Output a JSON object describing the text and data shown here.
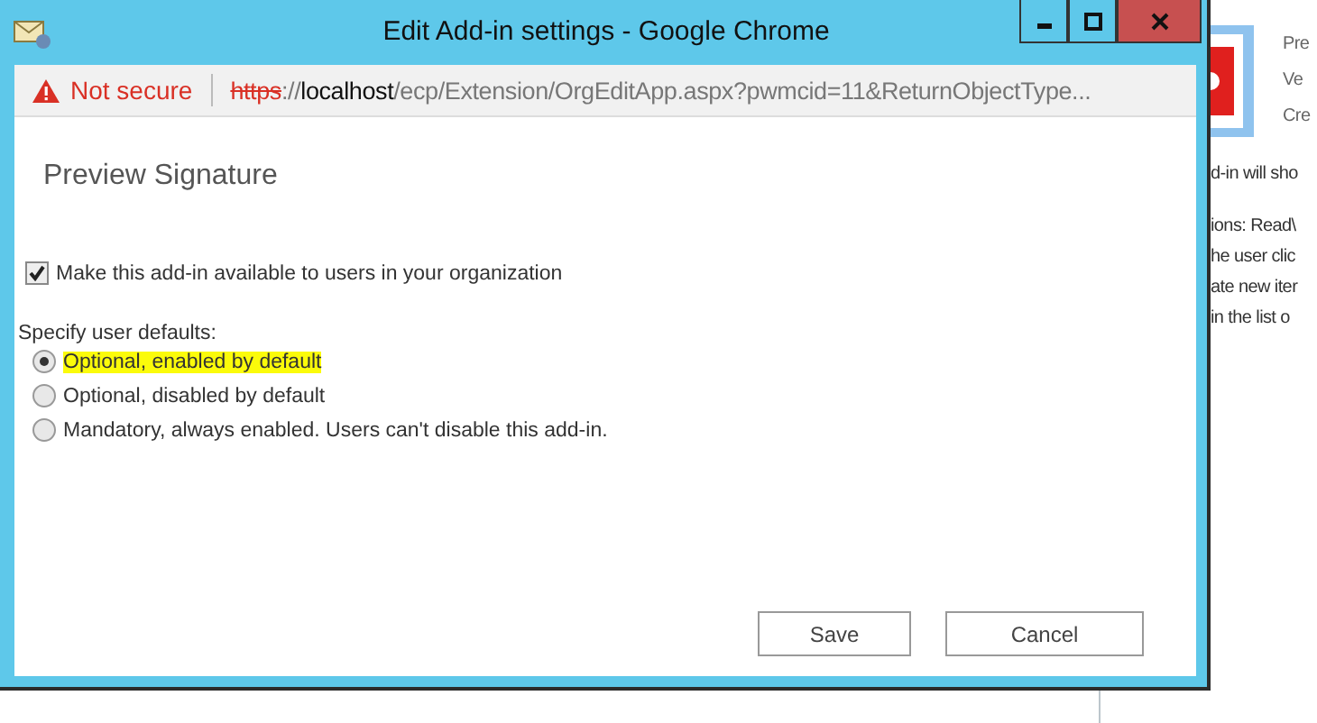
{
  "window": {
    "title": "Edit Add-in settings - Google Chrome"
  },
  "address_bar": {
    "security_label": "Not secure",
    "url": [
      {
        "kind": "scheme",
        "text": "https"
      },
      {
        "kind": "path",
        "text": "://"
      },
      {
        "kind": "host",
        "text": "localhost"
      },
      {
        "kind": "path",
        "text": "/ecp/Extension/OrgEditApp.aspx?pwmcid=11&ReturnObjectType..."
      }
    ]
  },
  "dialog": {
    "heading": "Preview Signature",
    "availability": {
      "label": "Make this add-in available to users in your organization",
      "checked": true
    },
    "defaults_label": "Specify user defaults:",
    "options": [
      {
        "label": "Optional, enabled by default",
        "selected": true,
        "highlighted": true
      },
      {
        "label": "Optional, disabled by default",
        "selected": false,
        "highlighted": false
      },
      {
        "label": "Mandatory, always enabled. Users can't disable this add-in.",
        "selected": false,
        "highlighted": false
      }
    ],
    "buttons": [
      "Save",
      "Cancel"
    ]
  },
  "background_page": {
    "header_lines": [
      "Pre",
      "Ve",
      "Cre"
    ],
    "body_lines": [
      "d-in will sho",
      "ions: Read\\",
      "he user clic",
      "ate new iter",
      "in the list o"
    ]
  }
}
